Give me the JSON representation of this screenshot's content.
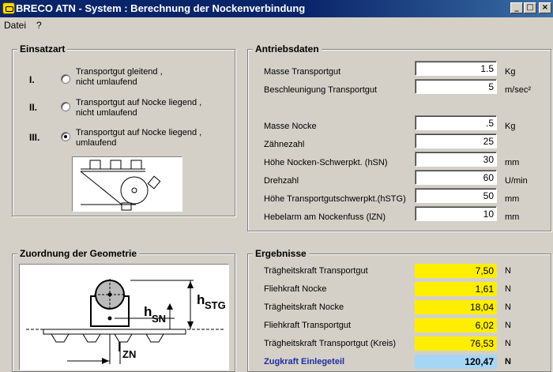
{
  "window": {
    "title": "BRECO ATN - System : Berechnung der Nockenverbindung",
    "min_glyph": "_",
    "max_glyph": "□",
    "close_glyph": "×"
  },
  "menu": [
    {
      "label": "Datei"
    },
    {
      "label": "?"
    }
  ],
  "einsatzart": {
    "title": "Einsatzart",
    "options": [
      {
        "numeral": "I.",
        "label_line1": "Transportgut gleitend ,",
        "label_line2": "nicht umlaufend",
        "checked": false
      },
      {
        "numeral": "II.",
        "label_line1": "Transportgut auf Nocke liegend ,",
        "label_line2": "nicht umlaufend",
        "checked": false
      },
      {
        "numeral": "III.",
        "label_line1": "Transportgut auf Nocke liegend ,",
        "label_line2": "umlaufend",
        "checked": true
      }
    ]
  },
  "antriebsdaten": {
    "title": "Antriebsdaten",
    "fields": [
      {
        "label": "Masse Transportgut",
        "value": "1.5",
        "unit": "Kg"
      },
      {
        "label": "Beschleunigung Transportgut",
        "value": "5",
        "unit": "m/sec²"
      },
      {
        "label": "Masse Nocke",
        "value": ".5",
        "unit": "Kg"
      },
      {
        "label": "Zähnezahl",
        "value": "25",
        "unit": ""
      },
      {
        "label": "Höhe Nocken-Schwerpkt. (hSN)",
        "value": "30",
        "unit": "mm"
      },
      {
        "label": "Drehzahl",
        "value": "60",
        "unit": "U/min"
      },
      {
        "label": "Höhe Transportgutschwerpkt.(hSTG)",
        "value": "50",
        "unit": "mm"
      },
      {
        "label": "Hebelarm am Nockenfuss (lZN)",
        "value": "10",
        "unit": "mm"
      }
    ]
  },
  "geometrie": {
    "title": "Zuordnung der Geometrie",
    "label_h": "h",
    "label_stg": "STG",
    "label_sn": "SN",
    "label_l": "l",
    "label_zn": "ZN"
  },
  "ergebnisse": {
    "title": "Ergebnisse",
    "rows": [
      {
        "label": "Trägheitskraft Transportgut",
        "value": "7,50",
        "unit": "N"
      },
      {
        "label": "Fliehkraft Nocke",
        "value": "1,61",
        "unit": "N"
      },
      {
        "label": "Trägheitskraft Nocke",
        "value": "18,04",
        "unit": "N"
      },
      {
        "label": "Fliehkraft Transportgut",
        "value": "6,02",
        "unit": "N"
      },
      {
        "label": "Trägheitskraft Transportgut (Kreis)",
        "value": "76,53",
        "unit": "N"
      },
      {
        "label": "Zugkraft Einlegeteil",
        "value": "120,47",
        "unit": "N"
      }
    ]
  },
  "colors": {
    "titlebar": "#0a246a",
    "result_bg": "#ffee00",
    "total_bg": "#a6d6f5",
    "total_text": "#1f2fa0"
  }
}
